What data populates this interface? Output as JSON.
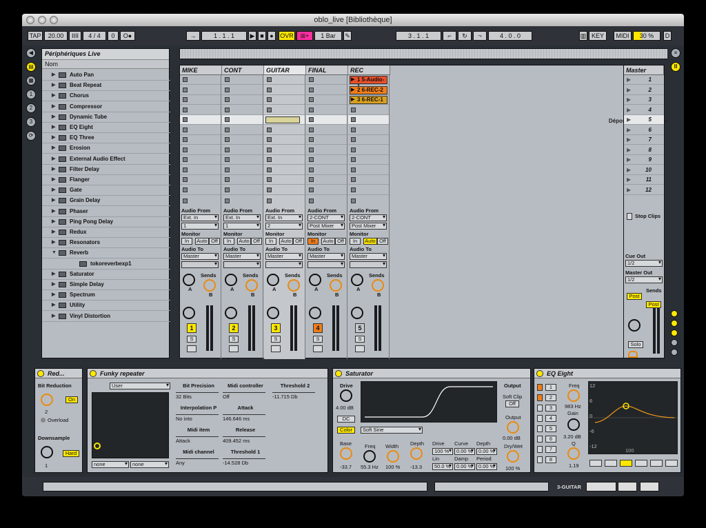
{
  "window": {
    "title": "oblo_live  [Bibliothèque]"
  },
  "control_bar": {
    "tap": "TAP",
    "tempo": "20.00",
    "metro": "IIII",
    "signature": "4 / 4",
    "nudge": "0",
    "ctl_o": "O●",
    "arrow": "→",
    "position": "1 .   1 .   1",
    "ovr": "OVR",
    "add": "⊞+",
    "quantize": "1 Bar",
    "loop_start": "3 .   1 .   1",
    "loop_len": "4 .   0 .   0",
    "key": "KEY",
    "midi": "MIDI",
    "cpu": "30 %",
    "d": "D"
  },
  "browser": {
    "title": "Périphériques Live",
    "column": "Nom",
    "items": [
      {
        "label": "Auto Pan"
      },
      {
        "label": "Beat Repeat"
      },
      {
        "label": "Chorus"
      },
      {
        "label": "Compressor"
      },
      {
        "label": "Dynamic Tube"
      },
      {
        "label": "EQ Eight"
      },
      {
        "label": "EQ Three"
      },
      {
        "label": "Erosion"
      },
      {
        "label": "External Audio Effect"
      },
      {
        "label": "Filter Delay"
      },
      {
        "label": "Flanger"
      },
      {
        "label": "Gate"
      },
      {
        "label": "Grain Delay"
      },
      {
        "label": "Phaser"
      },
      {
        "label": "Ping Pong Delay"
      },
      {
        "label": "Redux"
      },
      {
        "label": "Resonators"
      },
      {
        "label": "Reverb",
        "expanded": true
      },
      {
        "label": "tokoreverbexp1",
        "child": true
      },
      {
        "label": "Saturator"
      },
      {
        "label": "Simple Delay"
      },
      {
        "label": "Spectrum"
      },
      {
        "label": "Utility"
      },
      {
        "label": "Vinyl Distortion"
      }
    ]
  },
  "session": {
    "drop_text": "Déposez ici les clips et périphériques",
    "tracks": [
      {
        "name": "MIKE",
        "clip": null,
        "audio_from": "Ext. In",
        "channel": "1",
        "monitor_active": "none",
        "audio_to": "Master",
        "number": "1",
        "num_color": "#ffe800"
      },
      {
        "name": "CONT",
        "clip": null,
        "audio_from": "Ext. In",
        "channel": "1",
        "monitor_active": "none",
        "audio_to": "Master",
        "number": "2",
        "num_color": "#ffe800"
      },
      {
        "name": "GUITAR",
        "clip": null,
        "audio_from": "Ext. In",
        "channel": "2",
        "monitor_active": "none",
        "audio_to": "Master",
        "number": "3",
        "num_color": "#ffe800"
      },
      {
        "name": "FINAL",
        "clip": null,
        "audio_from": "2-CONT",
        "channel": "Post Mixer",
        "monitor_active": "In",
        "audio_to": "Master",
        "number": "4",
        "num_color": "#f07d1a"
      },
      {
        "name": "REC",
        "clips": [
          "1 5-Audio-1",
          "2 6-REC-2",
          "3 6-REC-1"
        ],
        "clip_colors": [
          "#e8502a",
          "#f07d1a",
          "#d9a01e"
        ],
        "audio_from": "2-CONT",
        "channel": "Post Mixer",
        "monitor_active": "Auto",
        "audio_to": "Master",
        "number": "5",
        "num_color": "#c4c8cc"
      }
    ],
    "io_labels": {
      "audio_from": "Audio From",
      "monitor": "Monitor",
      "audio_to": "Audio To",
      "in": "In",
      "auto": "Auto",
      "off": "Off",
      "sends": "Sends",
      "a": "A",
      "b": "B",
      "s": "S"
    },
    "master": {
      "name": "Master",
      "scenes": [
        "1",
        "2",
        "3",
        "4",
        "5",
        "6",
        "7",
        "8",
        "9",
        "10",
        "11",
        "12"
      ],
      "stop_clips": "Stop Clips",
      "cue_out": "Cue Out",
      "cue_val": "1/2",
      "master_out": "Master Out",
      "master_val": "1/2",
      "post": "Post",
      "solo": "Solo",
      "sends": "Sends"
    }
  },
  "devices": {
    "redux": {
      "title": "Red...",
      "bit_reduction": "Bit Reduction",
      "bit_val": "2",
      "on": "On",
      "overload": "Overload",
      "downsample": "Downsample",
      "down_val": "1",
      "hard": "Hard"
    },
    "funky": {
      "title": "Funky repeater",
      "preset": "User",
      "none1": "none",
      "none2": "none",
      "params": [
        {
          "name": "Bit Precision",
          "value": "32 Bits"
        },
        {
          "name": "Midi controller",
          "value": "Off"
        },
        {
          "name": "Threshold 2",
          "value": "-11.715 Db"
        },
        {
          "name": "Interpolation P",
          "value": "No into"
        },
        {
          "name": "Attack",
          "value": "146.646 ms"
        },
        {
          "name": "Midi item",
          "value": "Attack"
        },
        {
          "name": "Release",
          "value": "409.452 ms"
        },
        {
          "name": "Midi channel",
          "value": "Any"
        },
        {
          "name": "Threshold 1",
          "value": "-14.528 Db"
        }
      ]
    },
    "saturator": {
      "title": "Saturator",
      "drive": "Drive",
      "drive_val": "4.00 dB",
      "dc": "DC",
      "color": "Color",
      "curve": "Soft Sine",
      "output": "Output",
      "soft_clip": "Soft Clip",
      "soft_val": "Off",
      "output_label": "Output",
      "output_val": "0.00 dB",
      "drywet": "Dry/Wet",
      "drywet_val": "100 %",
      "base": "Base",
      "base_val": "-33.7",
      "freq": "Freq",
      "freq_val": "55.3 Hz",
      "width": "Width",
      "width_val": "100 %",
      "depth": "Depth",
      "depth_val": "-13.3",
      "grid": [
        [
          "Drive",
          "Curve",
          "Depth"
        ],
        [
          "100 %",
          "0.00 %",
          "0.00 %"
        ],
        [
          "Lin",
          "Damp",
          "Period"
        ],
        [
          "50.0 %",
          "0.00 %",
          "0.00 %"
        ]
      ]
    },
    "eq": {
      "title": "EQ Eight",
      "freq": "Freq",
      "freq_val": "983 Hz",
      "gain": "Gain",
      "gain_val": "3.20 dB",
      "q": "Q",
      "q_val": "1.19",
      "bands": [
        "1",
        "2",
        "3",
        "4",
        "5",
        "6",
        "7",
        "8"
      ],
      "scale": [
        "12",
        "6",
        "0",
        "-6",
        "-12"
      ],
      "axis": "100"
    }
  },
  "status": {
    "track": "3-GUITAR"
  }
}
